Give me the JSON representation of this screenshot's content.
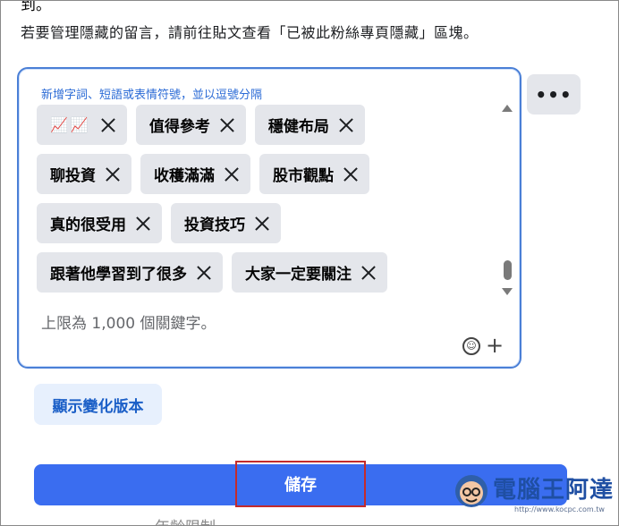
{
  "top_clipped_text": "到。",
  "helper_text": "若要管理隱藏的留言，請前往貼文查看「已被此粉絲專頁隱藏」區塊。",
  "keyword_field": {
    "label": "新增字詞、短語或表情符號，並以逗號分隔",
    "limit_text": "上限為 1,000 個關鍵字。",
    "chips": [
      {
        "text": "📈📈"
      },
      {
        "text": "值得參考"
      },
      {
        "text": "穩健布局"
      },
      {
        "text": "聊投資"
      },
      {
        "text": "收穫滿滿"
      },
      {
        "text": "股市觀點"
      },
      {
        "text": "真的很受用"
      },
      {
        "text": "投資技巧"
      },
      {
        "text": "跟著他學習到了很多"
      },
      {
        "text": "大家一定要關注"
      }
    ]
  },
  "more_button_label": "•••",
  "version_button_label": "顯示變化版本",
  "save_button_label": "儲存",
  "bottom_clipped_text": "年齡限制",
  "watermark": {
    "title": "電腦王阿達",
    "url": "http://www.kocpc.com.tw"
  }
}
